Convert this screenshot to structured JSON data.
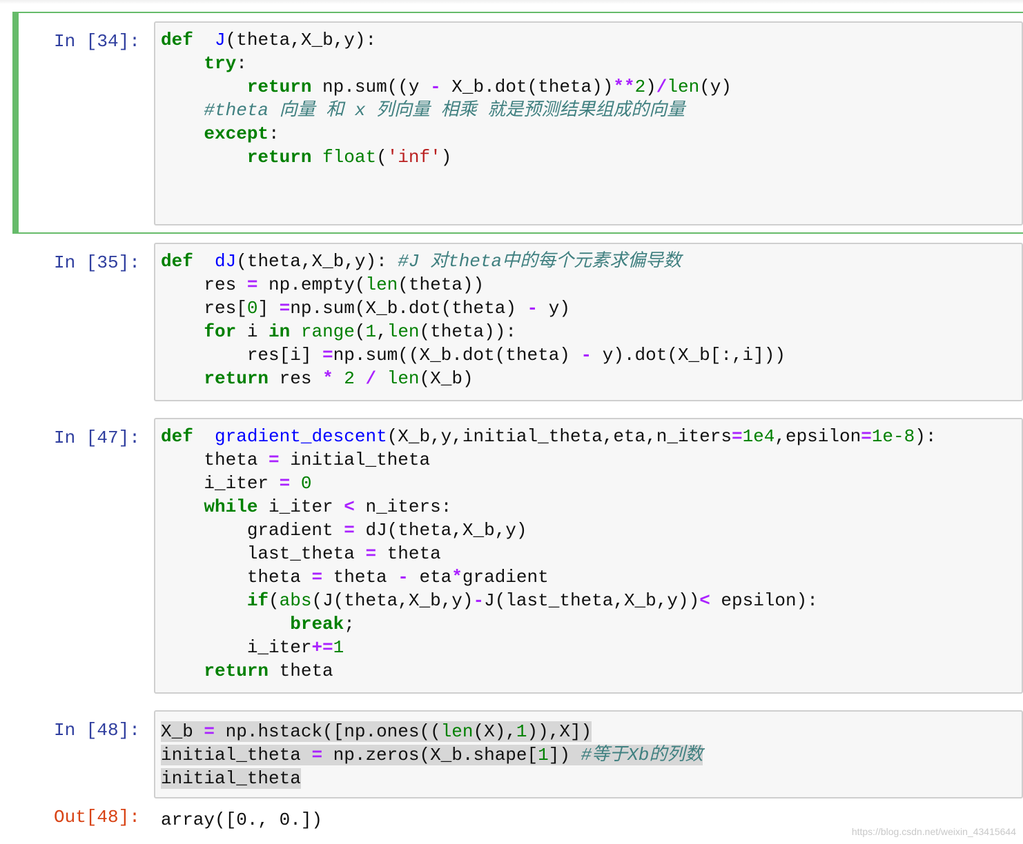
{
  "cells": [
    {
      "prompt": "In [34]:",
      "lines": [
        [
          [
            "kw",
            "def"
          ],
          [
            "",
            "  "
          ],
          [
            "fn",
            "J"
          ],
          [
            "",
            "(theta,X_b,y):"
          ]
        ],
        [
          [
            "",
            "    "
          ],
          [
            "kw",
            "try"
          ],
          [
            "",
            ":"
          ]
        ],
        [
          [
            "",
            "        "
          ],
          [
            "kw",
            "return"
          ],
          [
            "",
            " np.sum((y "
          ],
          [
            "op",
            "-"
          ],
          [
            "",
            " X_b.dot(theta))"
          ],
          [
            "op",
            "**"
          ],
          [
            "num",
            "2"
          ],
          [
            "",
            ")"
          ],
          [
            "op",
            "/"
          ],
          [
            "bi",
            "len"
          ],
          [
            "",
            "(y)"
          ]
        ],
        [
          [
            "",
            "    "
          ],
          [
            "cm",
            "#theta 向量 和 x 列向量 相乘 就是预测结果组成的向量"
          ]
        ],
        [
          [
            "",
            "    "
          ],
          [
            "kw",
            "except"
          ],
          [
            "",
            ":"
          ]
        ],
        [
          [
            "",
            "        "
          ],
          [
            "kw",
            "return"
          ],
          [
            "",
            "",
            " "
          ],
          [
            "bi",
            "float"
          ],
          [
            "",
            "("
          ],
          [
            "str",
            "'inf'"
          ],
          [
            "",
            ")"
          ]
        ]
      ]
    },
    {
      "prompt": "In [35]:",
      "lines": [
        [
          [
            "kw",
            "def"
          ],
          [
            "",
            "  "
          ],
          [
            "fn",
            "dJ"
          ],
          [
            "",
            "(theta,X_b,y): "
          ],
          [
            "cm",
            "#J 对theta中的每个元素求偏导数"
          ]
        ],
        [
          [
            "",
            "    res "
          ],
          [
            "op",
            "="
          ],
          [
            "",
            " np.empty("
          ],
          [
            "bi",
            "len"
          ],
          [
            "",
            "(theta))"
          ]
        ],
        [
          [
            "",
            "    res["
          ],
          [
            "num",
            "0"
          ],
          [
            "",
            "] "
          ],
          [
            "op",
            "="
          ],
          [
            "",
            "np.sum(X_b.dot(theta) "
          ],
          [
            "op",
            "-"
          ],
          [
            "",
            " y)"
          ]
        ],
        [
          [
            "",
            "    "
          ],
          [
            "kw",
            "for"
          ],
          [
            "",
            " i "
          ],
          [
            "kw",
            "in"
          ],
          [
            "",
            " "
          ],
          [
            "bi",
            "range"
          ],
          [
            "",
            "("
          ],
          [
            "num",
            "1"
          ],
          [
            "",
            ","
          ],
          [
            "bi",
            "len"
          ],
          [
            "",
            "(theta)):"
          ]
        ],
        [
          [
            "",
            "        res[i] "
          ],
          [
            "op",
            "="
          ],
          [
            "",
            "np.sum((X_b.dot(theta) "
          ],
          [
            "op",
            "-"
          ],
          [
            "",
            " y).dot(X_b[:,i]))"
          ]
        ],
        [
          [
            "",
            "    "
          ],
          [
            "kw",
            "return"
          ],
          [
            "",
            " res "
          ],
          [
            "op",
            "*"
          ],
          [
            "",
            " "
          ],
          [
            "num",
            "2"
          ],
          [
            "",
            " "
          ],
          [
            "op",
            "/"
          ],
          [
            "",
            " "
          ],
          [
            "bi",
            "len"
          ],
          [
            "",
            "(X_b)"
          ]
        ]
      ]
    },
    {
      "prompt": "In [47]:",
      "lines": [
        [
          [
            "kw",
            "def"
          ],
          [
            "",
            "  "
          ],
          [
            "fn",
            "gradient_descent"
          ],
          [
            "",
            "(X_b,y,initial_theta,eta,n_iters"
          ],
          [
            "op",
            "="
          ],
          [
            "num",
            "1e4"
          ],
          [
            "",
            ",epsilon"
          ],
          [
            "op",
            "="
          ],
          [
            "num",
            "1e-8"
          ],
          [
            "",
            "):"
          ]
        ],
        [
          [
            "",
            "    theta "
          ],
          [
            "op",
            "="
          ],
          [
            "",
            " initial_theta"
          ]
        ],
        [
          [
            "",
            "    i_iter "
          ],
          [
            "op",
            "="
          ],
          [
            "",
            " "
          ],
          [
            "num",
            "0"
          ]
        ],
        [
          [
            "",
            "    "
          ],
          [
            "kw",
            "while"
          ],
          [
            "",
            " i_iter "
          ],
          [
            "op",
            "<"
          ],
          [
            "",
            " n_iters:"
          ]
        ],
        [
          [
            "",
            "        gradient "
          ],
          [
            "op",
            "="
          ],
          [
            "",
            " dJ(theta,X_b,y)"
          ]
        ],
        [
          [
            "",
            "        last_theta "
          ],
          [
            "op",
            "="
          ],
          [
            "",
            " theta"
          ]
        ],
        [
          [
            "",
            "        theta "
          ],
          [
            "op",
            "="
          ],
          [
            "",
            " theta "
          ],
          [
            "op",
            "-"
          ],
          [
            "",
            " eta"
          ],
          [
            "op",
            "*"
          ],
          [
            "",
            "gradient"
          ]
        ],
        [
          [
            "",
            "        "
          ],
          [
            "kw",
            "if"
          ],
          [
            "",
            "("
          ],
          [
            "bi",
            "abs"
          ],
          [
            "",
            "(J(theta,X_b,y)"
          ],
          [
            "op",
            "-"
          ],
          [
            "",
            "J(last_theta,X_b,y))"
          ],
          [
            "op",
            "<"
          ],
          [
            "",
            " epsilon):"
          ]
        ],
        [
          [
            "",
            "            "
          ],
          [
            "kw",
            "break"
          ],
          [
            "",
            ";"
          ]
        ],
        [
          [
            "",
            "        i_iter"
          ],
          [
            "op",
            "+="
          ],
          [
            "num",
            "1"
          ]
        ],
        [
          [
            "",
            "    "
          ],
          [
            "kw",
            "return"
          ],
          [
            "",
            " theta"
          ]
        ]
      ]
    },
    {
      "prompt": "In [48]:",
      "lines": [
        [
          [
            "",
            "X_b "
          ],
          [
            "op",
            "="
          ],
          [
            "",
            " np.hstack([np.ones(("
          ],
          [
            "bi",
            "len"
          ],
          [
            "",
            "(X),"
          ],
          [
            "num",
            "1"
          ],
          [
            "",
            ")),X])"
          ]
        ],
        [
          [
            "",
            "initial_theta "
          ],
          [
            "op",
            "="
          ],
          [
            "",
            " np.zeros(X_b.shape["
          ],
          [
            "num",
            "1"
          ],
          [
            "",
            "]) "
          ],
          [
            "cm",
            "#等于Xb的列数"
          ]
        ],
        [
          [
            "",
            "initial_theta"
          ]
        ]
      ],
      "out_prompt": "Out[48]:",
      "output": "array([0., 0.])"
    }
  ],
  "watermark": "https://blog.csdn.net/weixin_43415644"
}
